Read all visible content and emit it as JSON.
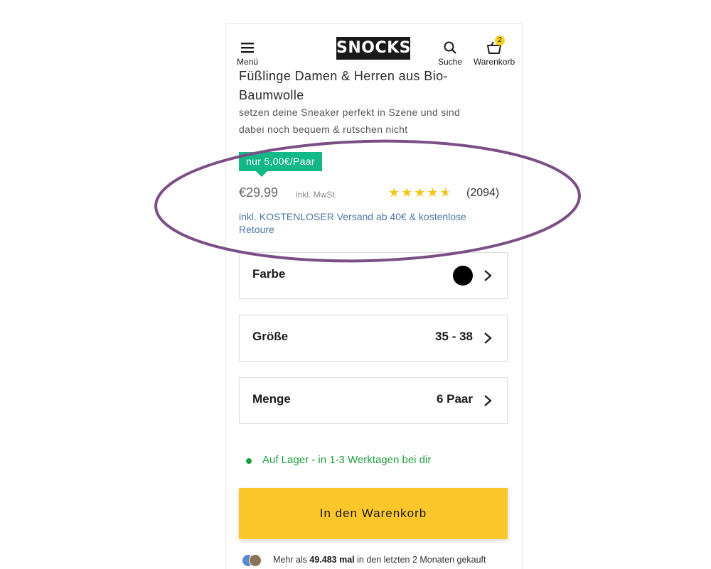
{
  "header": {
    "menu_label": "Menü",
    "logo": "SNOCKS",
    "search_label": "Suche",
    "cart_label": "Warenkorb",
    "cart_count": "2"
  },
  "product": {
    "title_line1": "Füßlinge Damen & Herren aus Bio-",
    "title_line2": "Baumwolle",
    "subtitle_line1": "setzen deine Sneaker perfekt in Szene und sind",
    "subtitle_line2": "dabei noch bequem & rutschen nicht",
    "per_pair_badge": "nur 5,00€/Paar",
    "price": "€29,99",
    "vat_note": "inkl. MwSt.",
    "rating": 4.5,
    "review_count": "(2094)",
    "shipping_line1": "inkl. KOSTENLOSER Versand ab 40€ & kostenlose",
    "shipping_line2": "Retoure"
  },
  "options": [
    {
      "label": "Farbe",
      "value": "",
      "swatch_color": "#000000"
    },
    {
      "label": "Größe",
      "value": "35 - 38"
    },
    {
      "label": "Menge",
      "value": "6 Paar"
    }
  ],
  "stock": {
    "text": "Auf Lager - in 1-3 Werktagen bei dir",
    "color": "#1f9e3e"
  },
  "cta": {
    "label": "In den Warenkorb",
    "color": "#fcc72b"
  },
  "social_proof": {
    "prefix": "Mehr als ",
    "count": "49.483 mal",
    "suffix": " in den letzten 2 Monaten gekauft"
  },
  "colors": {
    "badge_green": "#12b886",
    "star": "#f6c514",
    "link_blue": "#4a76a8",
    "annotation_ellipse": "#7b4f86"
  }
}
